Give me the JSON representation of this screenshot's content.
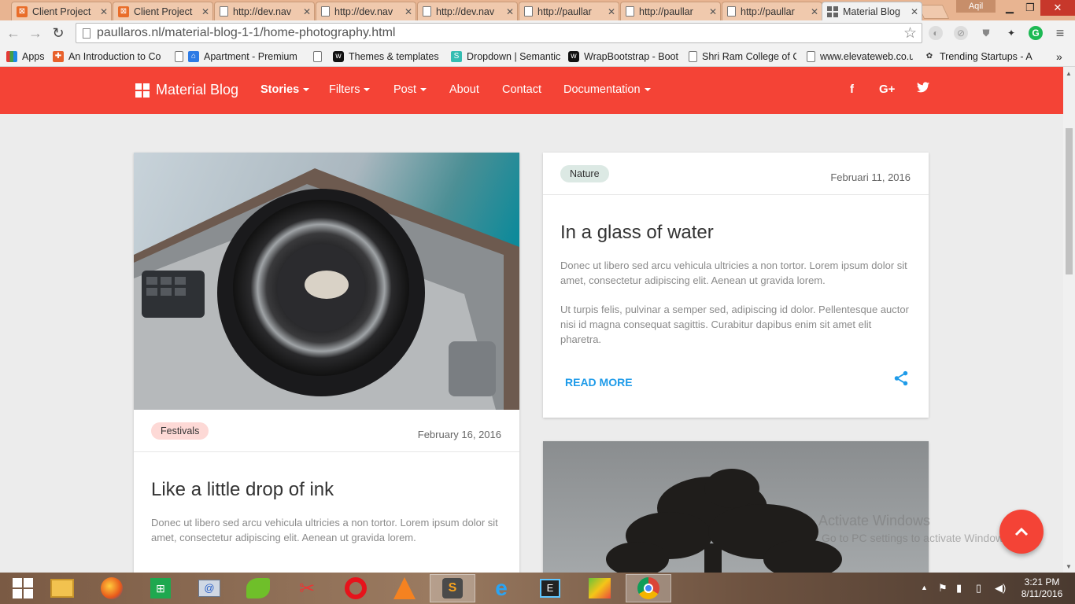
{
  "browser": {
    "tabs": [
      {
        "title": "Client Project",
        "icon": "xampp-icon"
      },
      {
        "title": "Client Project",
        "icon": "xampp-icon"
      },
      {
        "title": "http://dev.nav",
        "icon": "page-icon"
      },
      {
        "title": "http://dev.nav",
        "icon": "page-icon"
      },
      {
        "title": "http://dev.nav",
        "icon": "page-icon"
      },
      {
        "title": "http://paullar",
        "icon": "page-icon"
      },
      {
        "title": "http://paullar",
        "icon": "page-icon"
      },
      {
        "title": "http://paullar",
        "icon": "page-icon"
      },
      {
        "title": "Material Blog",
        "icon": "material-blog-icon"
      }
    ],
    "user": "Aqil",
    "url": "paullaros.nl/material-blog-1-1/home-photography.html",
    "bookmarks": [
      {
        "label": "Apps"
      },
      {
        "label": "An Introduction to Co"
      },
      {
        "label": "Apartment - Premium"
      },
      {
        "label": ""
      },
      {
        "label": "Themes & templates"
      },
      {
        "label": "Dropdown | Semantic"
      },
      {
        "label": "WrapBootstrap - Boot"
      },
      {
        "label": "Shri Ram College of C"
      },
      {
        "label": "www.elevateweb.co.ul"
      },
      {
        "label": "Trending Startups - A"
      }
    ]
  },
  "site": {
    "accent": "#f44336",
    "brand": "Material Blog",
    "nav": [
      {
        "label": "Stories"
      },
      {
        "label": "Filters"
      },
      {
        "label": "Post"
      },
      {
        "label": "About"
      },
      {
        "label": "Contact"
      },
      {
        "label": "Documentation"
      }
    ],
    "social": [
      "f",
      "G+",
      "twitter-icon"
    ]
  },
  "posts": {
    "left": {
      "tag": "Festivals",
      "date": "February 16, 2016",
      "title": "Like a little drop of ink",
      "text1": "Donec ut libero sed arcu vehicula ultricies a non tortor. Lorem ipsum dolor sit amet, consectetur adipiscing elit. Aenean ut gravida lorem."
    },
    "right": {
      "tag": "Nature",
      "date": "Februari 11, 2016",
      "title": "In a glass of water",
      "text1": "Donec ut libero sed arcu vehicula ultricies a non tortor. Lorem ipsum dolor sit amet, consectetur adipiscing elit. Aenean ut gravida lorem.",
      "text2": "Ut turpis felis, pulvinar a semper sed, adipiscing id dolor. Pellentesque auctor nisi id magna consequat sagittis. Curabitur dapibus enim sit amet elit pharetra.",
      "read_more": "READ MORE"
    }
  },
  "watermark": {
    "line1": "Activate Windows",
    "line2": "Go to PC settings to activate Windows."
  },
  "taskbar": {
    "time": "3:21 PM",
    "date": "8/11/2016"
  }
}
